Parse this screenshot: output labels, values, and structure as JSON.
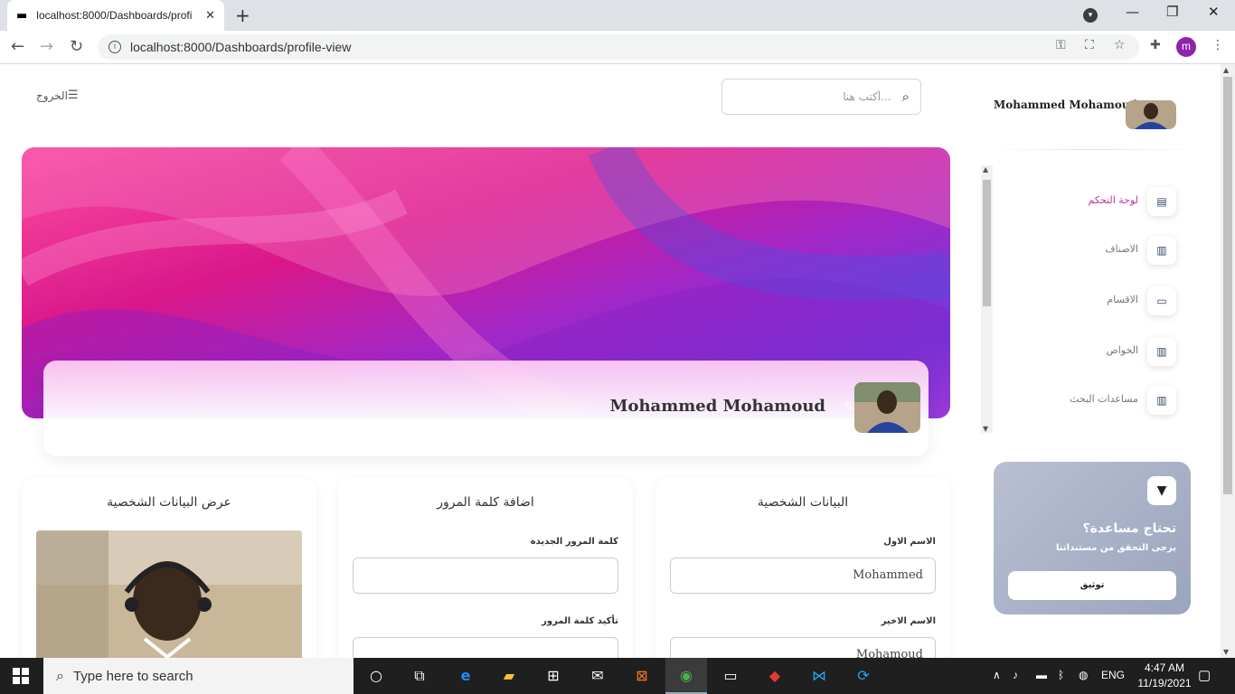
{
  "browser": {
    "tab_title": "localhost:8000/Dashboards/profi",
    "url": "localhost:8000/Dashboards/profile-view",
    "profile_initial": "m"
  },
  "header": {
    "logout_label": "الخروج",
    "search_placeholder": "أكتب هنا..."
  },
  "profile": {
    "name": "Mohammed Mohamoud"
  },
  "panels": {
    "view": {
      "title": "عرض البيانات الشخصية"
    },
    "password": {
      "title": "اضافة كلمة المرور",
      "new_label": "كلمة المرور الجديدة",
      "confirm_label": "تأكيد كلمة المرور"
    },
    "personal": {
      "title": "البيانات الشخصية",
      "first_label": "الاسم الاول",
      "first_value": "Mohammed",
      "last_label": "الاسم الاخير",
      "last_value": "Mohamoud"
    }
  },
  "sidebar": {
    "user_name": "Mohammed Mohamoud",
    "items": [
      {
        "label": "لوحة التحكم",
        "icon": "store-icon",
        "active": true
      },
      {
        "label": "الاصناف",
        "icon": "chart-icon",
        "active": false
      },
      {
        "label": "الاقسام",
        "icon": "card-icon",
        "active": false
      },
      {
        "label": "الخواص",
        "icon": "chart-icon",
        "active": false
      },
      {
        "label": "مساعدات البحث",
        "icon": "chart-icon",
        "active": false
      }
    ],
    "help": {
      "title": "تحتاج مساعدة؟",
      "subtitle": "يرجى التحقق من مستنداتنا",
      "button": "توثيق"
    }
  },
  "taskbar": {
    "search_placeholder": "Type here to search",
    "language": "ENG",
    "time": "4:47 AM",
    "date": "11/19/2021"
  }
}
